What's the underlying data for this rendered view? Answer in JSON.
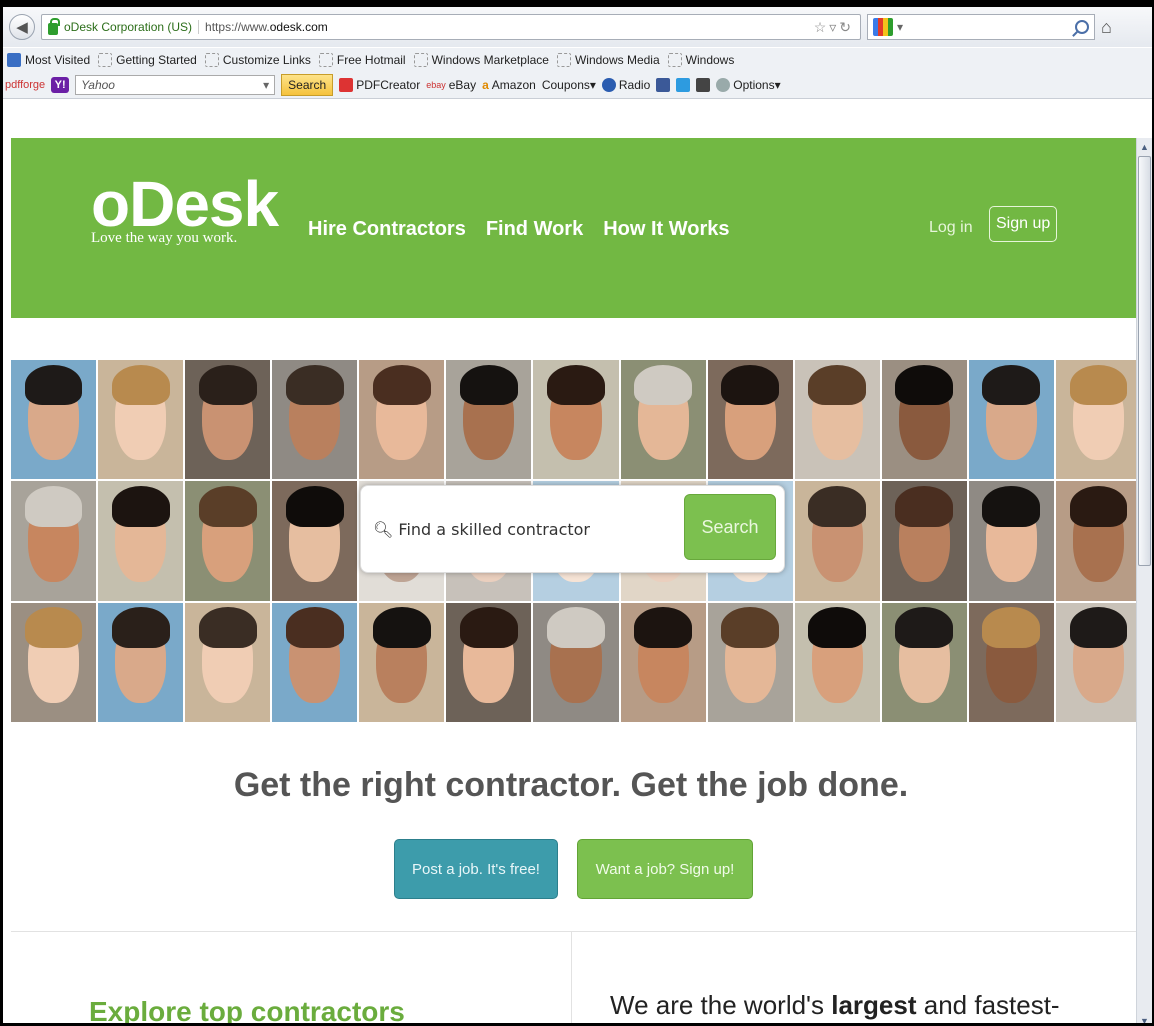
{
  "browser": {
    "identity": "oDesk Corporation (US)",
    "url_prefix": "https://www.",
    "url_domain": "odesk.com",
    "bookmarks": [
      "Most Visited",
      "Getting Started",
      "Customize Links",
      "Free Hotmail",
      "Windows Marketplace",
      "Windows Media",
      "Windows"
    ],
    "toolbar": {
      "pdfforge": "pdfforge",
      "search_engine": "Yahoo",
      "search_button": "Search",
      "items": [
        "PDFCreator",
        "eBay",
        "Amazon",
        "Coupons▾",
        "Radio",
        "Options▾"
      ]
    }
  },
  "header": {
    "logo": "oDesk",
    "logo_tagline": "Love the way you work.",
    "nav": [
      "Hire Contractors",
      "Find Work",
      "How It Works"
    ],
    "login": "Log in",
    "signup": "Sign up"
  },
  "hero": {
    "search_placeholder": "Find a skilled contractor",
    "search_button": "Search"
  },
  "main": {
    "tagline": "Get the right contractor. Get the job done.",
    "post_job": "Post a job. It's free!",
    "want_job": "Want a job? Sign up!",
    "explore_heading": "Explore top contractors",
    "world_text_pre": "We are the world's ",
    "world_text_bold": "largest",
    "world_text_post": " and fastest-"
  },
  "colors": {
    "brand_green": "#72b843",
    "button_teal": "#3d9cab",
    "button_green": "#7cc04f"
  }
}
